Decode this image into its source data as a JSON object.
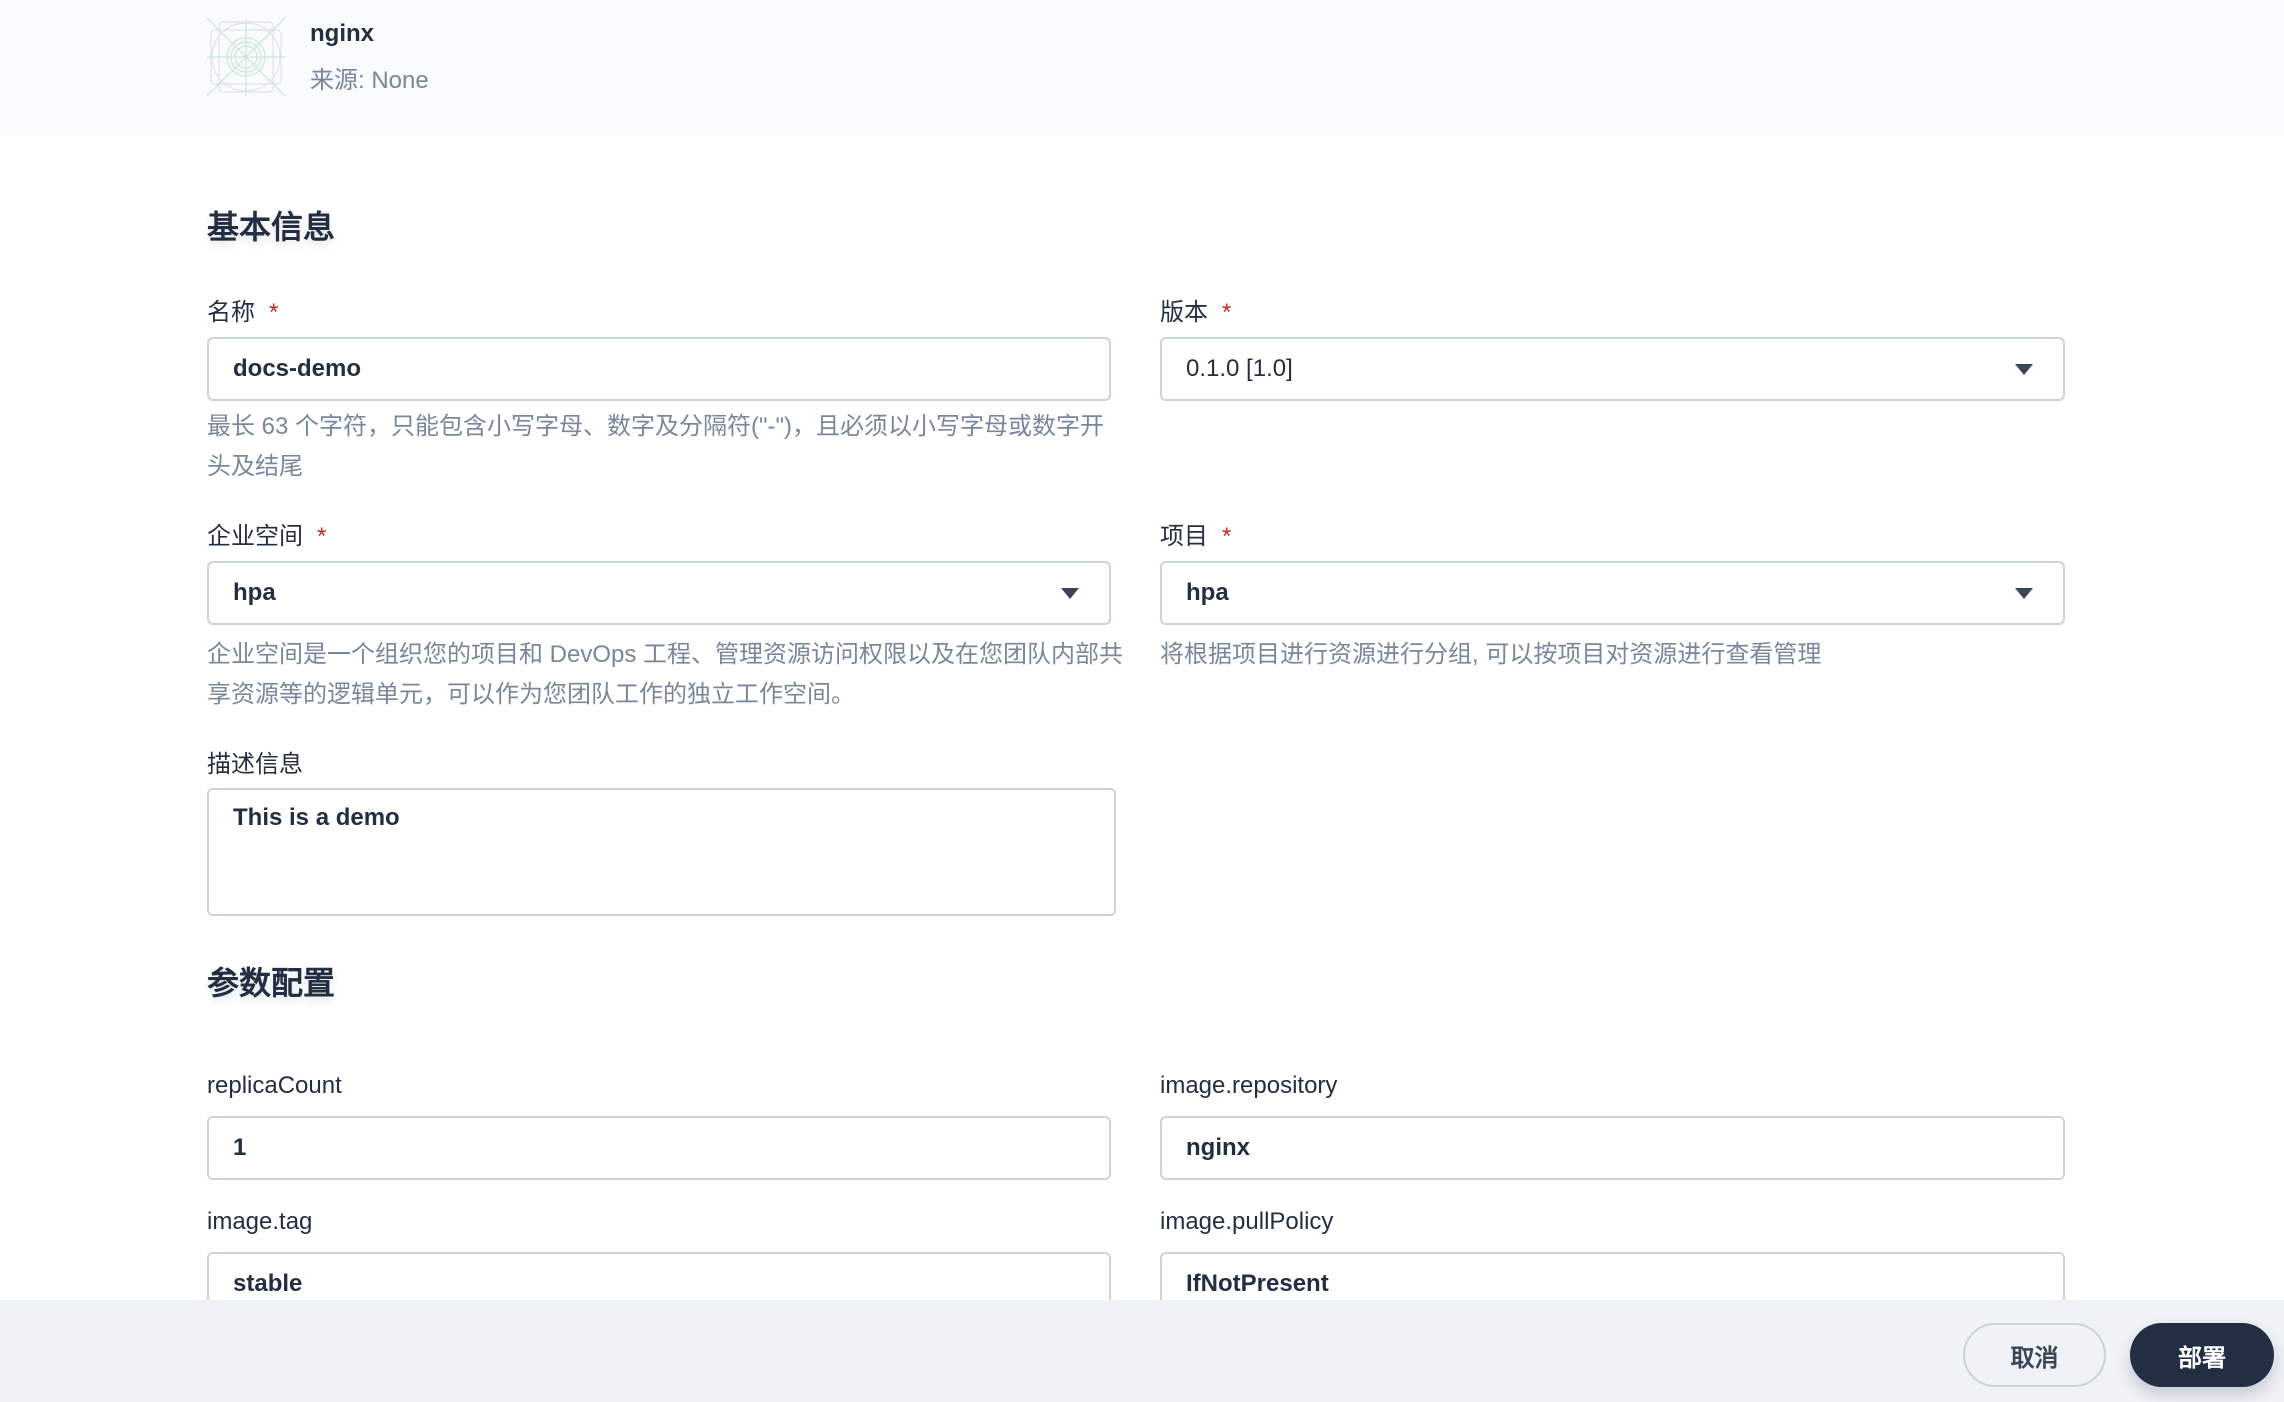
{
  "app": {
    "name": "nginx",
    "source": "来源: None",
    "icon": "app-placeholder-icon"
  },
  "basic": {
    "title": "基本信息",
    "name": {
      "label": "名称",
      "required": "*",
      "value": "docs-demo",
      "help": "最长 63 个字符，只能包含小写字母、数字及分隔符(\"-\")，且必须以小写字母或数字开头及结尾"
    },
    "version": {
      "label": "版本",
      "required": "*",
      "value": "0.1.0 [1.0]"
    },
    "workspace": {
      "label": "企业空间",
      "required": "*",
      "value": "hpa",
      "help": "企业空间是一个组织您的项目和 DevOps 工程、管理资源访问权限以及在您团队内部共享资源等的逻辑单元，可以作为您团队工作的独立工作空间。"
    },
    "project": {
      "label": "项目",
      "required": "*",
      "value": "hpa",
      "help": "将根据项目进行资源进行分组, 可以按项目对资源进行查看管理"
    },
    "description": {
      "label": "描述信息",
      "value": "This is a demo"
    }
  },
  "params": {
    "title": "参数配置",
    "fields": [
      {
        "label": "replicaCount",
        "value": "1"
      },
      {
        "label": "image.repository",
        "value": "nginx"
      },
      {
        "label": "image.tag",
        "value": "stable"
      },
      {
        "label": "image.pullPolicy",
        "value": "IfNotPresent"
      }
    ]
  },
  "footer": {
    "cancel": "取消",
    "deploy": "部署"
  }
}
